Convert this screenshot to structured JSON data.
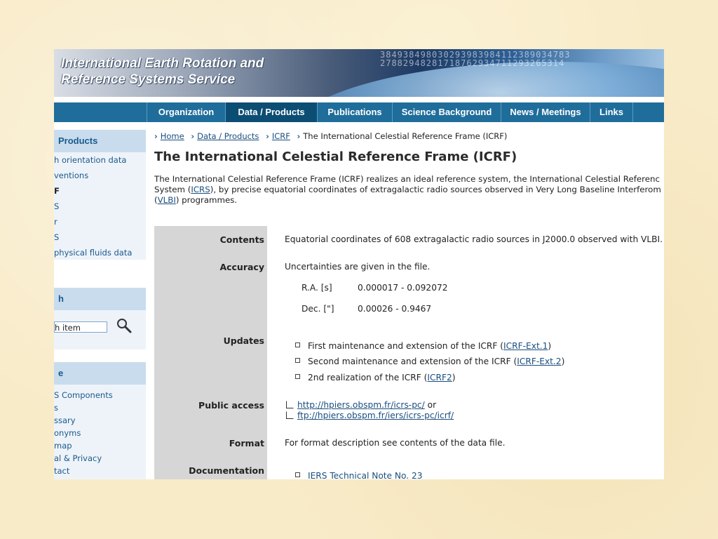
{
  "banner": {
    "title_line1": "International Earth Rotation and",
    "title_line2": "Reference Systems Service",
    "digits_line1": "384938498030293983984112389034783",
    "digits_line2": "27882948281718762934711293265314"
  },
  "nav": {
    "items": [
      {
        "label": "Organization"
      },
      {
        "label": "Data / Products"
      },
      {
        "label": "Publications"
      },
      {
        "label": "Science Background"
      },
      {
        "label": "News / Meetings"
      },
      {
        "label": "Links"
      }
    ],
    "active": "Data / Products"
  },
  "sidebar": {
    "products_heading": "Products",
    "products_items": [
      "h orientation data",
      "ventions",
      "F",
      "S",
      "r",
      "S",
      "physical fluids data"
    ],
    "search_heading": "h",
    "search_placeholder": "h item",
    "misc_heading": "e",
    "misc_items": [
      "S Components",
      "s",
      "ssary",
      "onyms",
      "map",
      "al & Privacy",
      "tact"
    ]
  },
  "breadcrumb": {
    "home": "Home",
    "data_products": "Data / Products",
    "icrf": "ICRF",
    "current": "The International Celestial Reference Frame (ICRF)"
  },
  "page": {
    "title": "The International Celestial Reference Frame (ICRF)",
    "intro_part1": "The International Celestial Reference Frame (ICRF) realizes an ideal reference system, the International Celestial Referenc",
    "intro_part2a": "System (",
    "intro_link_icrs": "ICRS",
    "intro_part2b": "), by precise equatorial coordinates of extragalactic radio sources observed in Very Long Baseline Interferom",
    "intro_part3a": "(",
    "intro_link_vlbi": "VLBI",
    "intro_part3b": ") programmes."
  },
  "table": {
    "contents_label": "Contents",
    "contents_value": "Equatorial coordinates of 608 extragalactic radio sources in J2000.0 observed with VLBI.",
    "accuracy_label": "Accuracy",
    "accuracy_value": "Uncertainties are given in the file.",
    "ra_label": "R.A. [s]",
    "ra_value": "0.000017 - 0.092072",
    "dec_label": "Dec. [\"]",
    "dec_value": "0.00026 - 0.9467",
    "updates_label": "Updates",
    "updates": [
      {
        "text": "First maintenance and extension of the ICRF (",
        "link": "ICRF-Ext.1",
        "end": ")"
      },
      {
        "text": "Second maintenance and extension of the ICRF (",
        "link": "ICRF-Ext.2",
        "end": ")"
      },
      {
        "text": "2nd realization of the ICRF (",
        "link": "ICRF2",
        "end": ")"
      }
    ],
    "public_access_label": "Public access",
    "public_link1": "http://hpiers.obspm.fr/icrs-pc/",
    "public_link1_suffix": " or",
    "public_link2": "ftp://hpiers.obspm.fr/iers/icrs-pc/icrf/",
    "format_label": "Format",
    "format_value": "For format description see contents of the data file.",
    "documentation_label": "Documentation",
    "documentation_link": "IERS Technical Note No. 23"
  }
}
